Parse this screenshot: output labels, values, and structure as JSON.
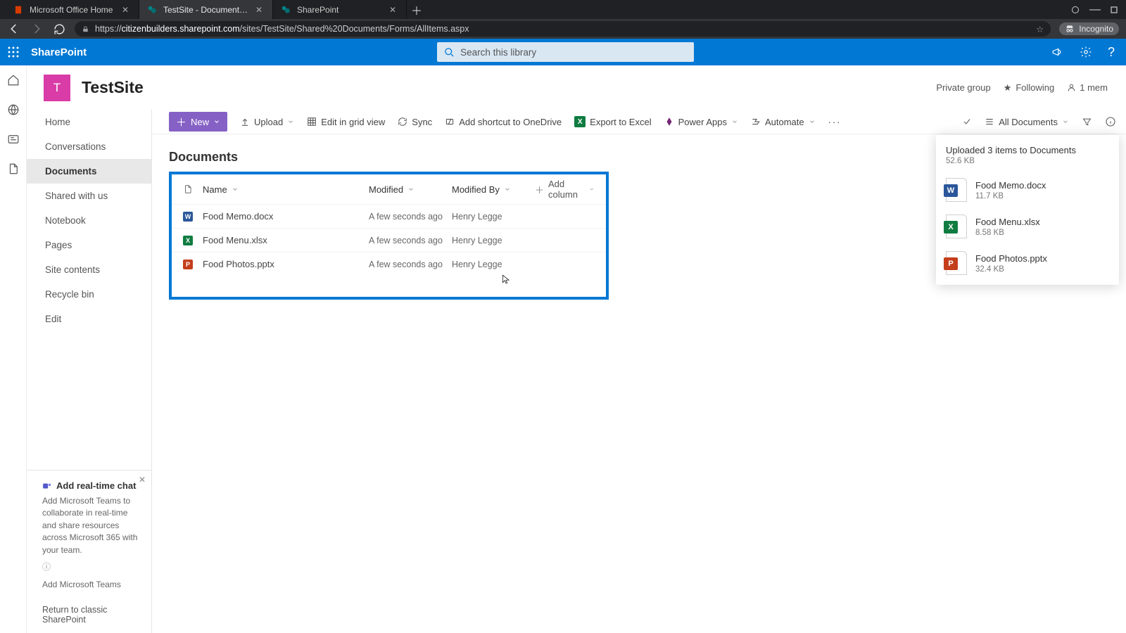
{
  "browser": {
    "tabs": [
      {
        "label": "Microsoft Office Home"
      },
      {
        "label": "TestSite - Documents - All Docu…"
      },
      {
        "label": "SharePoint"
      }
    ],
    "url_prefix": "https://",
    "url_domain": "citizenbuilders.sharepoint.com",
    "url_path": "/sites/TestSite/Shared%20Documents/Forms/AllItems.aspx",
    "incognito_label": "Incognito"
  },
  "header": {
    "app_name": "SharePoint",
    "search_placeholder": "Search this library"
  },
  "site": {
    "logo_letter": "T",
    "title": "TestSite",
    "privacy": "Private group",
    "following": "Following",
    "members": "1 mem"
  },
  "leftnav": {
    "items": [
      "Home",
      "Conversations",
      "Documents",
      "Shared with us",
      "Notebook",
      "Pages",
      "Site contents",
      "Recycle bin",
      "Edit"
    ],
    "selected_index": 2,
    "teams": {
      "title": "Add real-time chat",
      "desc": "Add Microsoft Teams to collaborate in real-time and share resources across Microsoft 365 with your team.",
      "link": "Add Microsoft Teams"
    },
    "classic": "Return to classic SharePoint"
  },
  "cmdbar": {
    "new": "New",
    "upload": "Upload",
    "edit_grid": "Edit in grid view",
    "sync": "Sync",
    "shortcut": "Add shortcut to OneDrive",
    "export_excel": "Export to Excel",
    "power_apps": "Power Apps",
    "automate": "Automate",
    "view_name": "All Documents"
  },
  "library": {
    "title": "Documents",
    "columns": {
      "name": "Name",
      "modified": "Modified",
      "modified_by": "Modified By",
      "add": "Add column"
    },
    "rows": [
      {
        "icon": "w",
        "name": "Food Memo.docx",
        "modified": "A few seconds ago",
        "by": "Henry Legge"
      },
      {
        "icon": "x",
        "name": "Food Menu.xlsx",
        "modified": "A few seconds ago",
        "by": "Henry Legge"
      },
      {
        "icon": "p",
        "name": "Food Photos.pptx",
        "modified": "A few seconds ago",
        "by": "Henry Legge"
      }
    ]
  },
  "toast": {
    "title": "Uploaded 3 items to Documents",
    "size": "52.6 KB",
    "items": [
      {
        "icon": "w",
        "name": "Food Memo.docx",
        "size": "11.7 KB"
      },
      {
        "icon": "x",
        "name": "Food Menu.xlsx",
        "size": "8.58 KB"
      },
      {
        "icon": "p",
        "name": "Food Photos.pptx",
        "size": "32.4 KB"
      }
    ]
  }
}
